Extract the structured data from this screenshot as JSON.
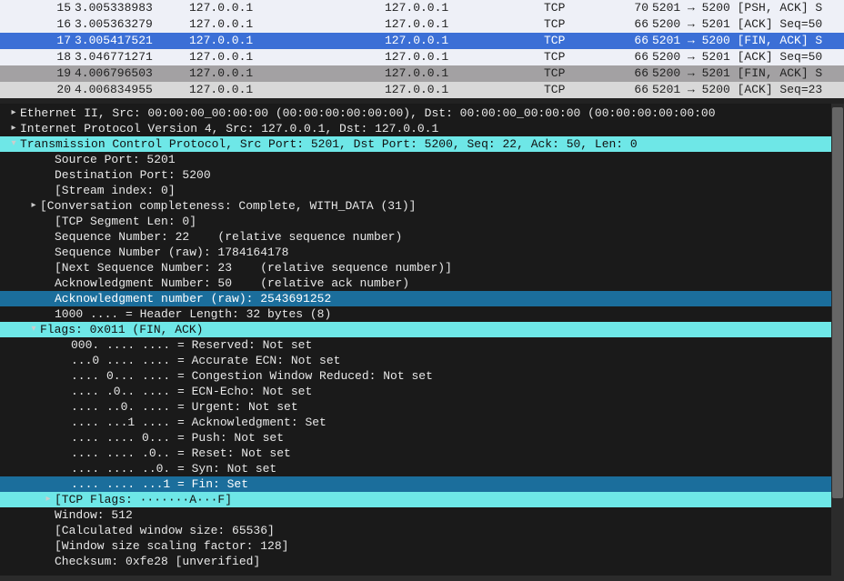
{
  "packet_list": [
    {
      "no": "15",
      "time": "3.005338983",
      "src": "127.0.0.1",
      "dst": "127.0.0.1",
      "proto": "TCP",
      "len": "70",
      "info": "5201 → 5200 [PSH, ACK] S",
      "cls": ""
    },
    {
      "no": "16",
      "time": "3.005363279",
      "src": "127.0.0.1",
      "dst": "127.0.0.1",
      "proto": "TCP",
      "len": "66",
      "info": "5200 → 5201 [ACK] Seq=50",
      "cls": ""
    },
    {
      "no": "17",
      "time": "3.005417521",
      "src": "127.0.0.1",
      "dst": "127.0.0.1",
      "proto": "TCP",
      "len": "66",
      "info": "5201 → 5200 [FIN, ACK] S",
      "cls": "row-selected"
    },
    {
      "no": "18",
      "time": "3.046771271",
      "src": "127.0.0.1",
      "dst": "127.0.0.1",
      "proto": "TCP",
      "len": "66",
      "info": "5200 → 5201 [ACK] Seq=50",
      "cls": ""
    },
    {
      "no": "19",
      "time": "4.006796503",
      "src": "127.0.0.1",
      "dst": "127.0.0.1",
      "proto": "TCP",
      "len": "66",
      "info": "5200 → 5201 [FIN, ACK] S",
      "cls": "row-highlight"
    },
    {
      "no": "20",
      "time": "4.006834955",
      "src": "127.0.0.1",
      "dst": "127.0.0.1",
      "proto": "TCP",
      "len": "66",
      "info": "5201 → 5200 [ACK] Seq=23",
      "cls": "row-fedge"
    }
  ],
  "details": [
    {
      "ind": 0,
      "arrow": "▸",
      "txt": "Ethernet II, Src: 00:00:00_00:00:00 (00:00:00:00:00:00), Dst: 00:00:00_00:00:00 (00:00:00:00:00:00",
      "hl": ""
    },
    {
      "ind": 0,
      "arrow": "▸",
      "txt": "Internet Protocol Version 4, Src: 127.0.0.1, Dst: 127.0.0.1",
      "hl": ""
    },
    {
      "ind": 0,
      "arrow": "▾",
      "txt": "Transmission Control Protocol, Src Port: 5201, Dst Port: 5200, Seq: 22, Ack: 50, Len: 0",
      "hl": "hl-cyan"
    },
    {
      "ind": 2,
      "arrow": "",
      "txt": "Source Port: 5201",
      "hl": ""
    },
    {
      "ind": 2,
      "arrow": "",
      "txt": "Destination Port: 5200",
      "hl": ""
    },
    {
      "ind": 2,
      "arrow": "",
      "txt": "[Stream index: 0]",
      "hl": ""
    },
    {
      "ind": 1,
      "arrow": "▸",
      "txt": "[Conversation completeness: Complete, WITH_DATA (31)]",
      "hl": ""
    },
    {
      "ind": 2,
      "arrow": "",
      "txt": "[TCP Segment Len: 0]",
      "hl": ""
    },
    {
      "ind": 2,
      "arrow": "",
      "txt": "Sequence Number: 22    (relative sequence number)",
      "hl": ""
    },
    {
      "ind": 2,
      "arrow": "",
      "txt": "Sequence Number (raw): 1784164178",
      "hl": ""
    },
    {
      "ind": 2,
      "arrow": "",
      "txt": "[Next Sequence Number: 23    (relative sequence number)]",
      "hl": ""
    },
    {
      "ind": 2,
      "arrow": "",
      "txt": "Acknowledgment Number: 50    (relative ack number)",
      "hl": ""
    },
    {
      "ind": 2,
      "arrow": "",
      "txt": "Acknowledgment number (raw): 2543691252",
      "hl": "hl-blue"
    },
    {
      "ind": 2,
      "arrow": "",
      "txt": "1000 .... = Header Length: 32 bytes (8)",
      "hl": ""
    },
    {
      "ind": 1,
      "arrow": "▾",
      "txt": "Flags: 0x011 (FIN, ACK)",
      "hl": "hl-cyan"
    },
    {
      "ind": 3,
      "arrow": "",
      "txt": "000. .... .... = Reserved: Not set",
      "hl": ""
    },
    {
      "ind": 3,
      "arrow": "",
      "txt": "...0 .... .... = Accurate ECN: Not set",
      "hl": ""
    },
    {
      "ind": 3,
      "arrow": "",
      "txt": ".... 0... .... = Congestion Window Reduced: Not set",
      "hl": ""
    },
    {
      "ind": 3,
      "arrow": "",
      "txt": ".... .0.. .... = ECN-Echo: Not set",
      "hl": ""
    },
    {
      "ind": 3,
      "arrow": "",
      "txt": ".... ..0. .... = Urgent: Not set",
      "hl": ""
    },
    {
      "ind": 3,
      "arrow": "",
      "txt": ".... ...1 .... = Acknowledgment: Set",
      "hl": ""
    },
    {
      "ind": 3,
      "arrow": "",
      "txt": ".... .... 0... = Push: Not set",
      "hl": ""
    },
    {
      "ind": 3,
      "arrow": "",
      "txt": ".... .... .0.. = Reset: Not set",
      "hl": ""
    },
    {
      "ind": 3,
      "arrow": "",
      "txt": ".... .... ..0. = Syn: Not set",
      "hl": ""
    },
    {
      "ind": 3,
      "arrow": "",
      "txt": ".... .... ...1 = Fin: Set",
      "hl": "hl-blue"
    },
    {
      "ind": 2,
      "arrow": "▸",
      "txt": "[TCP Flags: ·······A···F]",
      "hl": "hl-cyan"
    },
    {
      "ind": 2,
      "arrow": "",
      "txt": "Window: 512",
      "hl": ""
    },
    {
      "ind": 2,
      "arrow": "",
      "txt": "[Calculated window size: 65536]",
      "hl": ""
    },
    {
      "ind": 2,
      "arrow": "",
      "txt": "[Window size scaling factor: 128]",
      "hl": ""
    },
    {
      "ind": 2,
      "arrow": "",
      "txt": "Checksum: 0xfe28 [unverified]",
      "hl": ""
    }
  ]
}
